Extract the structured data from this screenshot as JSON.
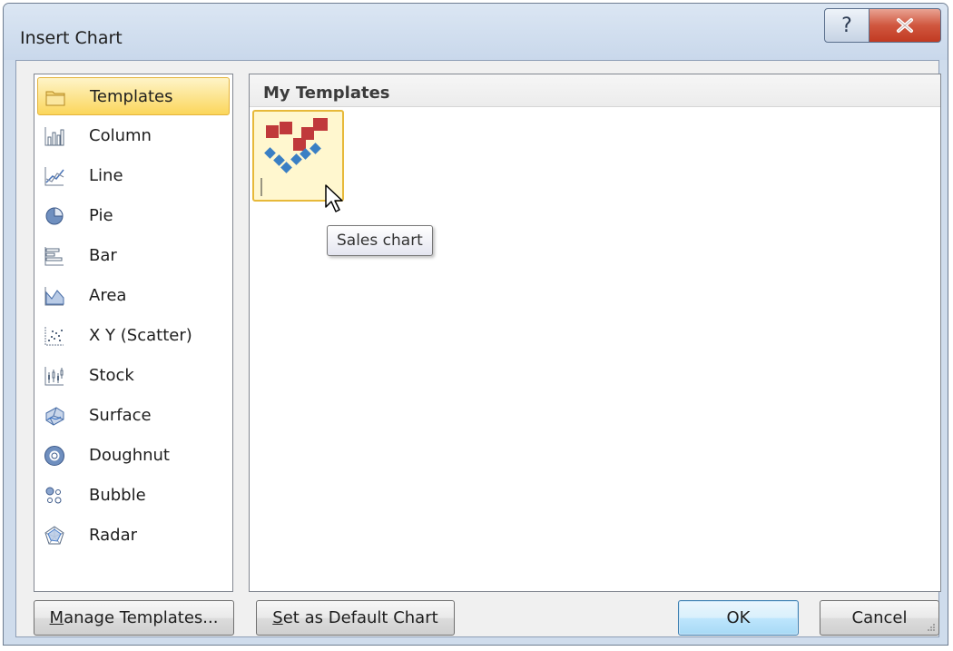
{
  "window": {
    "title": "Insert Chart",
    "help_label": "?"
  },
  "categories": [
    {
      "label": "Templates",
      "icon": "folder-icon",
      "selected": true
    },
    {
      "label": "Column",
      "icon": "column-chart-icon"
    },
    {
      "label": "Line",
      "icon": "line-chart-icon"
    },
    {
      "label": "Pie",
      "icon": "pie-chart-icon"
    },
    {
      "label": "Bar",
      "icon": "bar-chart-icon"
    },
    {
      "label": "Area",
      "icon": "area-chart-icon"
    },
    {
      "label": "X Y (Scatter)",
      "icon": "scatter-chart-icon"
    },
    {
      "label": "Stock",
      "icon": "stock-chart-icon"
    },
    {
      "label": "Surface",
      "icon": "surface-chart-icon"
    },
    {
      "label": "Doughnut",
      "icon": "doughnut-chart-icon"
    },
    {
      "label": "Bubble",
      "icon": "bubble-chart-icon"
    },
    {
      "label": "Radar",
      "icon": "radar-chart-icon"
    }
  ],
  "main": {
    "section_title": "My Templates",
    "templates": [
      {
        "tooltip": "Sales chart"
      }
    ]
  },
  "buttons": {
    "manage_templates": {
      "mnemonic": "M",
      "rest": "anage Templates..."
    },
    "set_default": {
      "mnemonic": "S",
      "rest": "et as Default Chart"
    },
    "ok": "OK",
    "cancel": "Cancel"
  },
  "colors": {
    "selection_fill": "#fbd65b",
    "template_red": "#c0393b",
    "template_blue": "#3a7fc4"
  }
}
